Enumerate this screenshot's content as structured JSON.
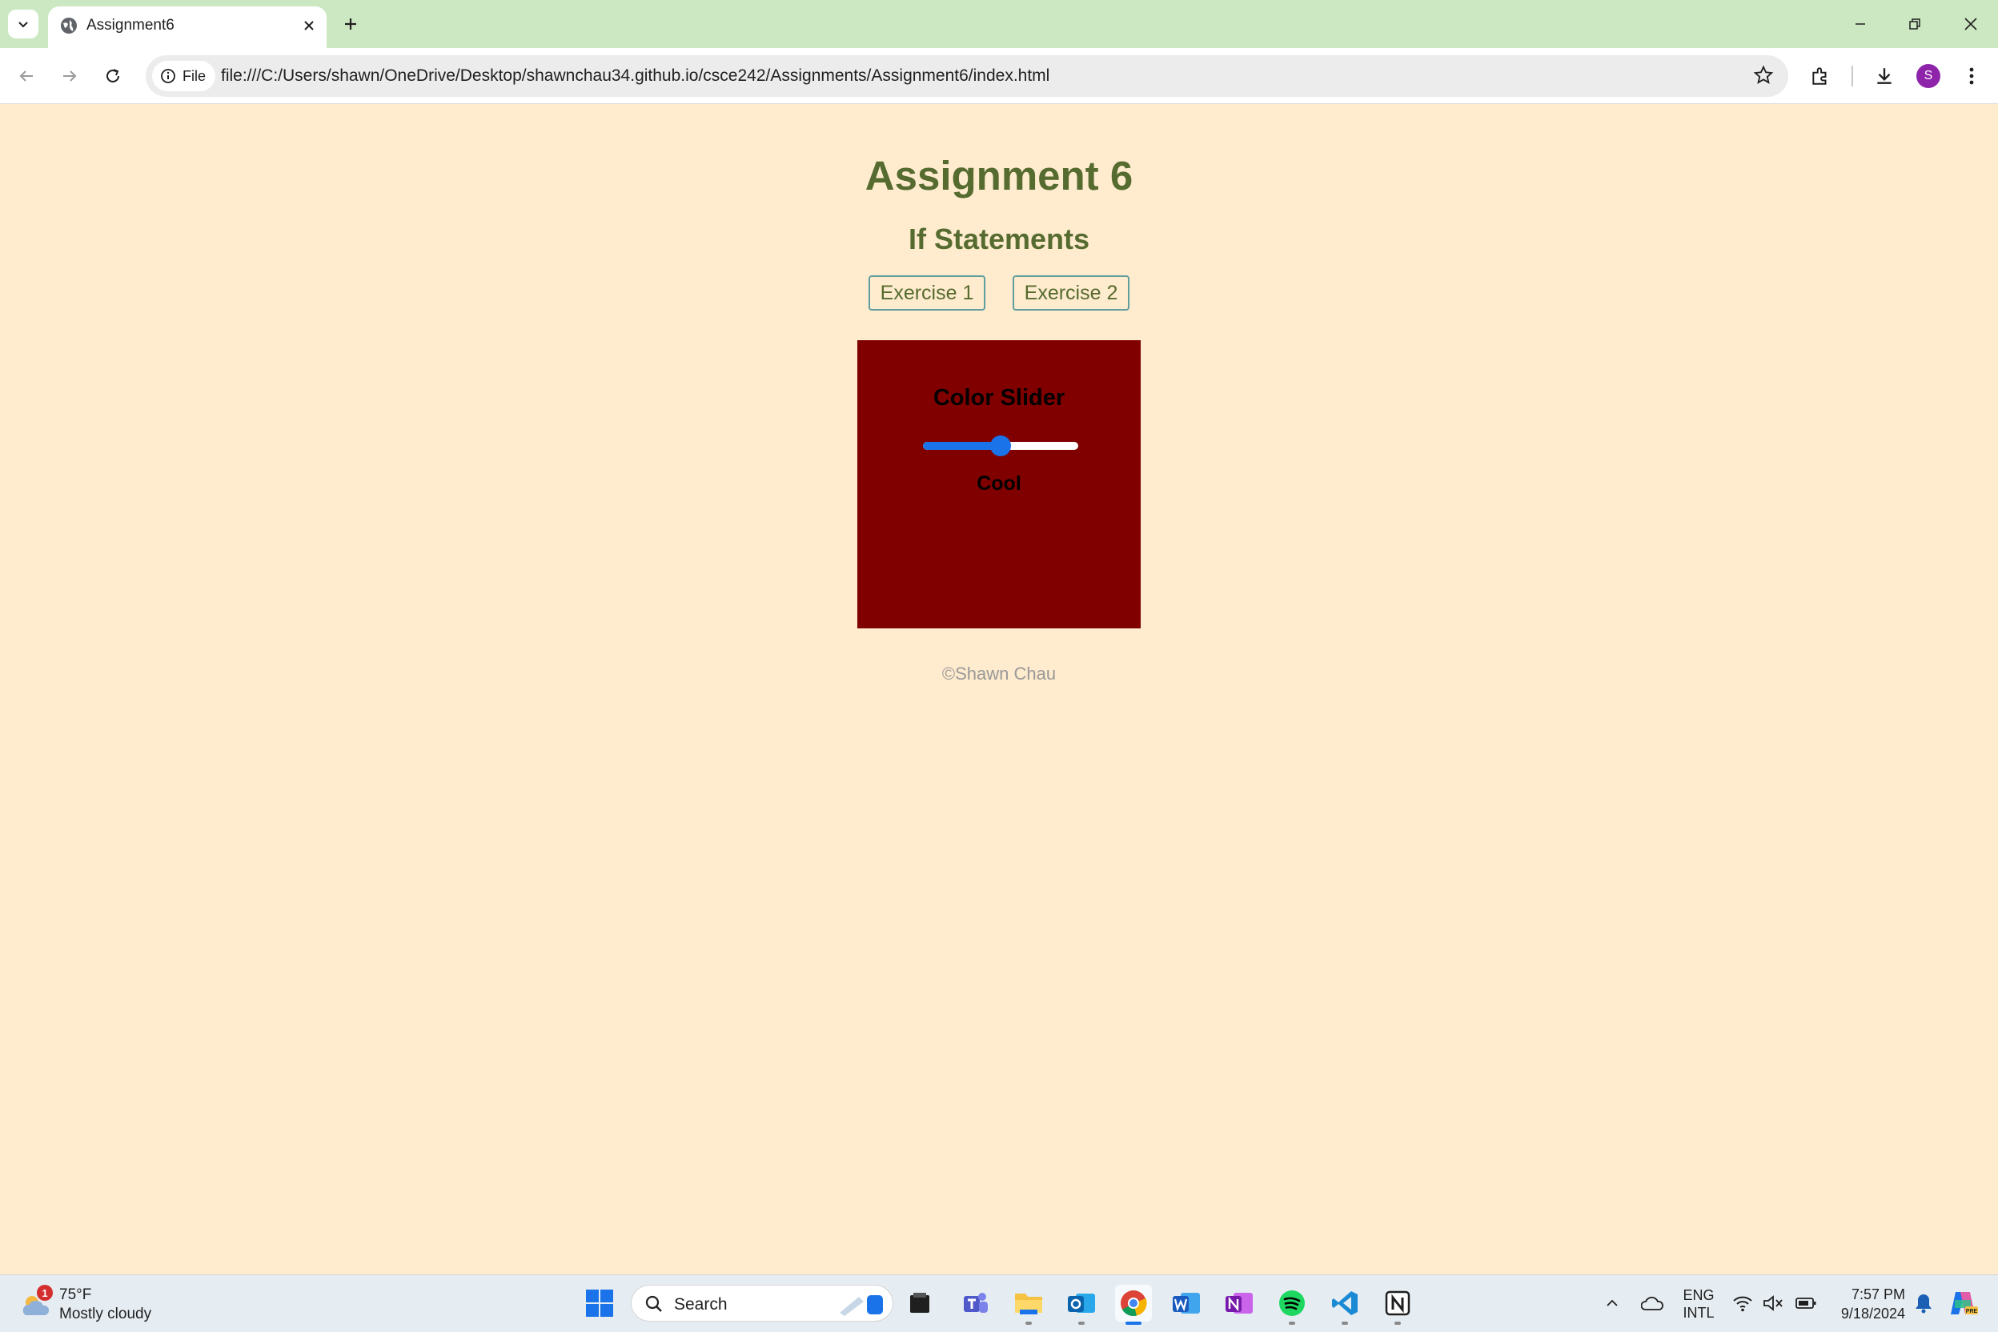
{
  "browser": {
    "tab_title": "Assignment6",
    "address_chip": "File",
    "url": "file:///C:/Users/shawn/OneDrive/Desktop/shawnchau34.github.io/csce242/Assignments/Assignment6/index.html",
    "profile_initial": "S",
    "profile_color": "#8e24aa"
  },
  "page": {
    "title": "Assignment 6",
    "subtitle": "If Statements",
    "buttons": [
      "Exercise 1",
      "Exercise 2"
    ],
    "slider_panel": {
      "heading": "Color Slider",
      "value_percent": 50,
      "label": "Cool",
      "background": "#800000"
    },
    "footer": "©Shawn Chau"
  },
  "colors": {
    "page_bg": "#ffebcd",
    "heading": "#556b2f",
    "button_border": "#5f9ea0",
    "accent": "#1a73e8"
  },
  "taskbar": {
    "weather": {
      "badge": "1",
      "temp": "75°F",
      "desc": "Mostly cloudy"
    },
    "search_placeholder": "Search",
    "apps": [
      "start-icon",
      "file-manager-icon",
      "teams-icon",
      "file-explorer-icon",
      "outlook-icon",
      "chrome-icon",
      "word-icon",
      "onenote-icon",
      "spotify-icon",
      "vscode-icon",
      "notion-icon"
    ],
    "language": {
      "line1": "ENG",
      "line2": "INTL"
    },
    "time": "7:57 PM",
    "date": "9/18/2024"
  }
}
